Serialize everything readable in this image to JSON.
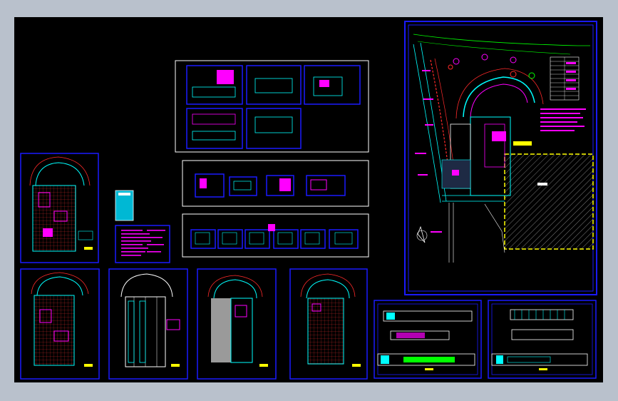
{
  "colors": {
    "background": "#000000",
    "frame_blue": "#1a1aff",
    "frame_white": "#ffffff",
    "cyan": "#00ffff",
    "magenta": "#ff00ff",
    "red": "#ff2a2a",
    "yellow": "#ffff00",
    "green": "#00ff00"
  },
  "sheets": [
    {
      "name": "site-plan-sheet"
    },
    {
      "name": "details-sheet-a"
    },
    {
      "name": "details-sheet-b"
    },
    {
      "name": "details-sheet-c"
    },
    {
      "name": "floor-plan-sheet-1"
    },
    {
      "name": "floor-plan-sheet-2"
    },
    {
      "name": "floor-plan-sheet-3"
    },
    {
      "name": "floor-plan-sheet-4"
    },
    {
      "name": "floor-plan-sheet-5"
    },
    {
      "name": "elevation-sheet-1"
    },
    {
      "name": "elevation-sheet-2"
    },
    {
      "name": "notes-sheet"
    },
    {
      "name": "legend-card"
    }
  ]
}
